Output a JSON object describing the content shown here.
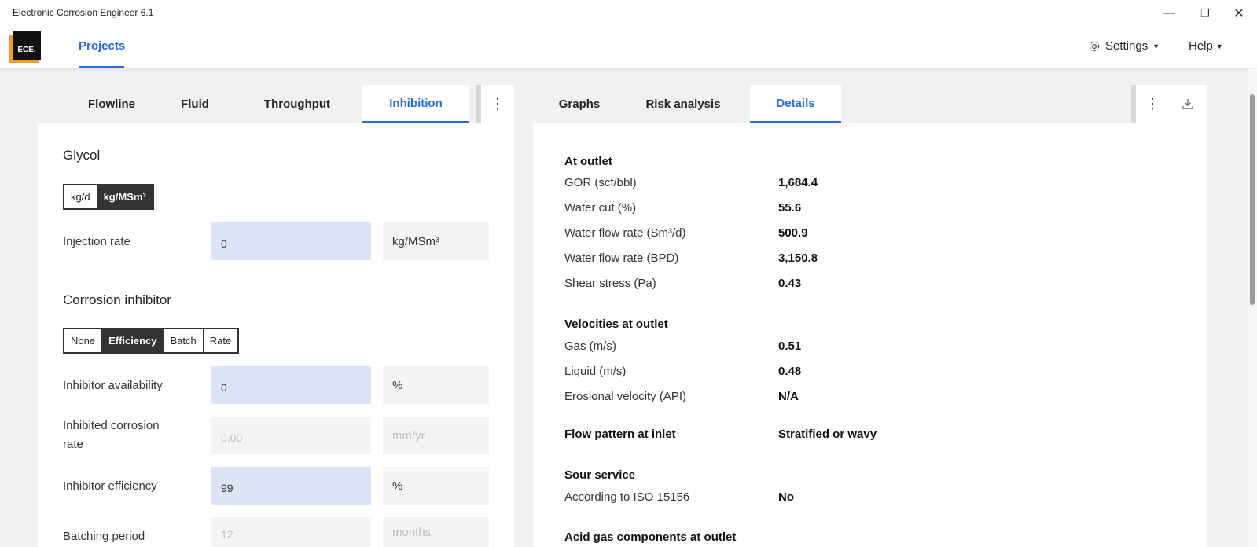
{
  "window": {
    "title": "Electronic Corrosion Engineer 6.1",
    "minimize": "—",
    "restore": "❐",
    "close": "✕"
  },
  "appbar": {
    "logo_text": "ECE.",
    "nav_projects": "Projects",
    "settings_label": "Settings",
    "help_label": "Help",
    "accent_color": "#2a6be0",
    "logo_color": "#f29a2e"
  },
  "left_tabs": [
    {
      "label": "Flowline"
    },
    {
      "label": "Fluid"
    },
    {
      "label": "Throughput"
    },
    {
      "label": "Inhibition"
    }
  ],
  "right_tabs": [
    {
      "label": "Graphs"
    },
    {
      "label": "Risk analysis"
    },
    {
      "label": "Details"
    }
  ],
  "glycol": {
    "title": "Glycol",
    "units": [
      "kg/d",
      "kg/MSm³"
    ],
    "selected_unit": "kg/MSm³",
    "injection_rate_label": "Injection rate",
    "injection_rate_value": "0",
    "injection_rate_unit": "kg/MSm³"
  },
  "corrosion_inhibitor": {
    "title": "Corrosion inhibitor",
    "modes": [
      "None",
      "Efficiency",
      "Batch",
      "Rate"
    ],
    "selected_mode": "Efficiency",
    "availability_label": "Inhibitor availability",
    "availability_value": "0",
    "availability_unit": "%",
    "inhibited_rate_label_1": "Inhibited corrosion",
    "inhibited_rate_label_2": "rate",
    "inhibited_rate_value": "0.00",
    "inhibited_rate_unit": "mm/yr",
    "efficiency_label": "Inhibitor efficiency",
    "efficiency_value": "99",
    "efficiency_unit": "%",
    "batching_label": "Batching period",
    "batching_value": "12",
    "batching_unit": "months"
  },
  "details": {
    "outlet_head": "At outlet",
    "gor_label": "GOR (scf/bbl)",
    "gor_value": "1,684.4",
    "water_cut_label": "Water cut (%)",
    "water_cut_value": "55.6",
    "water_flow_sm3_label": "Water flow rate (Sm³/d)",
    "water_flow_sm3_value": "500.9",
    "water_flow_bpd_label": "Water flow rate (BPD)",
    "water_flow_bpd_value": "3,150.8",
    "shear_label": "Shear stress (Pa)",
    "shear_value": "0.43",
    "velocities_head": "Velocities at outlet",
    "gas_label": "Gas (m/s)",
    "gas_value": "0.51",
    "liquid_label": "Liquid (m/s)",
    "liquid_value": "0.48",
    "erosional_label": "Erosional velocity (API)",
    "erosional_value": "N/A",
    "flow_pattern_head": "Flow pattern at inlet",
    "flow_pattern_value": "Stratified or wavy",
    "sour_head": "Sour service",
    "iso_label": "According to ISO 15156",
    "iso_value": "No",
    "acid_head": "Acid gas components at outlet"
  }
}
